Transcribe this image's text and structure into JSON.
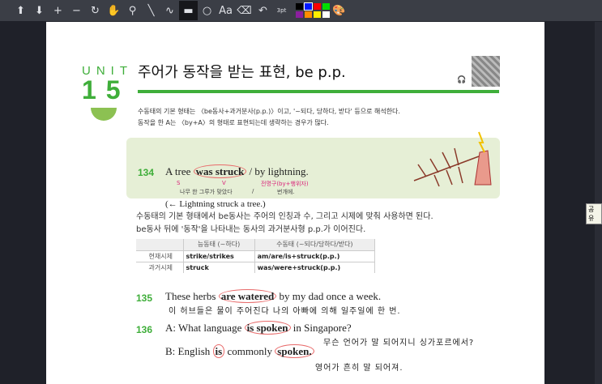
{
  "toolbar": {
    "tools": [
      {
        "name": "arrow-up-icon",
        "g": "⬆"
      },
      {
        "name": "arrow-down-icon",
        "g": "⬇"
      },
      {
        "name": "plus-icon",
        "g": "+"
      },
      {
        "name": "minus-icon",
        "g": "−"
      },
      {
        "name": "rotate-icon",
        "g": "↻"
      },
      {
        "name": "hand-icon",
        "g": "✋"
      },
      {
        "name": "zoom-icon",
        "g": "⚲"
      },
      {
        "name": "pen-icon",
        "g": "╲"
      },
      {
        "name": "freehand-icon",
        "g": "∿"
      },
      {
        "name": "highlighter-icon",
        "g": "▬"
      },
      {
        "name": "circle-icon",
        "g": "○"
      },
      {
        "name": "text-icon",
        "g": "Aa"
      },
      {
        "name": "eraser-icon",
        "g": "⌫"
      },
      {
        "name": "undo-icon",
        "g": "↶"
      }
    ],
    "stroke_label": "3pt",
    "colors": [
      "#000000",
      "#0019ff",
      "#ff0000",
      "#00dd00",
      "#8b1f9e",
      "#ff8c00",
      "#ffee00",
      "#ffffff"
    ],
    "selected_color": "#0019ff"
  },
  "tooltip": "공유",
  "page": {
    "unit_label": "UNIT",
    "unit_number": "15",
    "title": "주어가 동작을 받는 표현, be p.p.",
    "intro": [
      "수동태의 기본 형태는 〈be동사+과거분사(p.p.)〉이고, '~되다, 당하다, 받다' 등으로 해석한다.",
      "동작을 한 A는 〈by+A〉의 형태로 표현되는데 생략하는 경우가 많다."
    ],
    "ex134": {
      "num": "134",
      "pre": "A tree",
      "verb": "was struck",
      "post": "/ by lightning.",
      "s": "S",
      "v": "V",
      "pp": "전명구(by+행위자)",
      "kr1": "나무 한 그루가 맞았다",
      "slash": "/",
      "kr2": "번개에.",
      "active": "(← Lightning struck a tree.)"
    },
    "body": [
      "수동태의 기본 형태에서 be동사는 주어의 인칭과 수, 그리고 시제에 맞춰 사용하면 된다.",
      "be동사 뒤에 '동작'을 나타내는 동사의 과거분사형 p.p.가 이어진다."
    ],
    "table": {
      "headers": [
        "",
        "능동태 (~하다)",
        "수동태 (~되다/당하다/받다)"
      ],
      "rows": [
        [
          "현재시제",
          "strike/strikes",
          "am/are/is+struck(p.p.)"
        ],
        [
          "과거시제",
          "struck",
          "was/were+struck(p.p.)"
        ]
      ]
    },
    "ex135": {
      "num": "135",
      "pre": "These herbs",
      "verb": "are watered",
      "post": "by my dad once a week.",
      "kr": "이 허브들은 물이 주어진다 나의 아빠에 의해 일주일에 한 번."
    },
    "ex136": {
      "num": "136",
      "a_pre": "A: What language",
      "a_verb": "is spoken",
      "a_post": "in Singapore?",
      "a_kr": "무슨 언어가 말 되어지니 싱가포르에서?",
      "b_pre": "B: English",
      "b_is": "is",
      "b_mid": "commonly",
      "b_verb": "spoken.",
      "b_kr": "영어가 흔히 말 되어져."
    }
  }
}
